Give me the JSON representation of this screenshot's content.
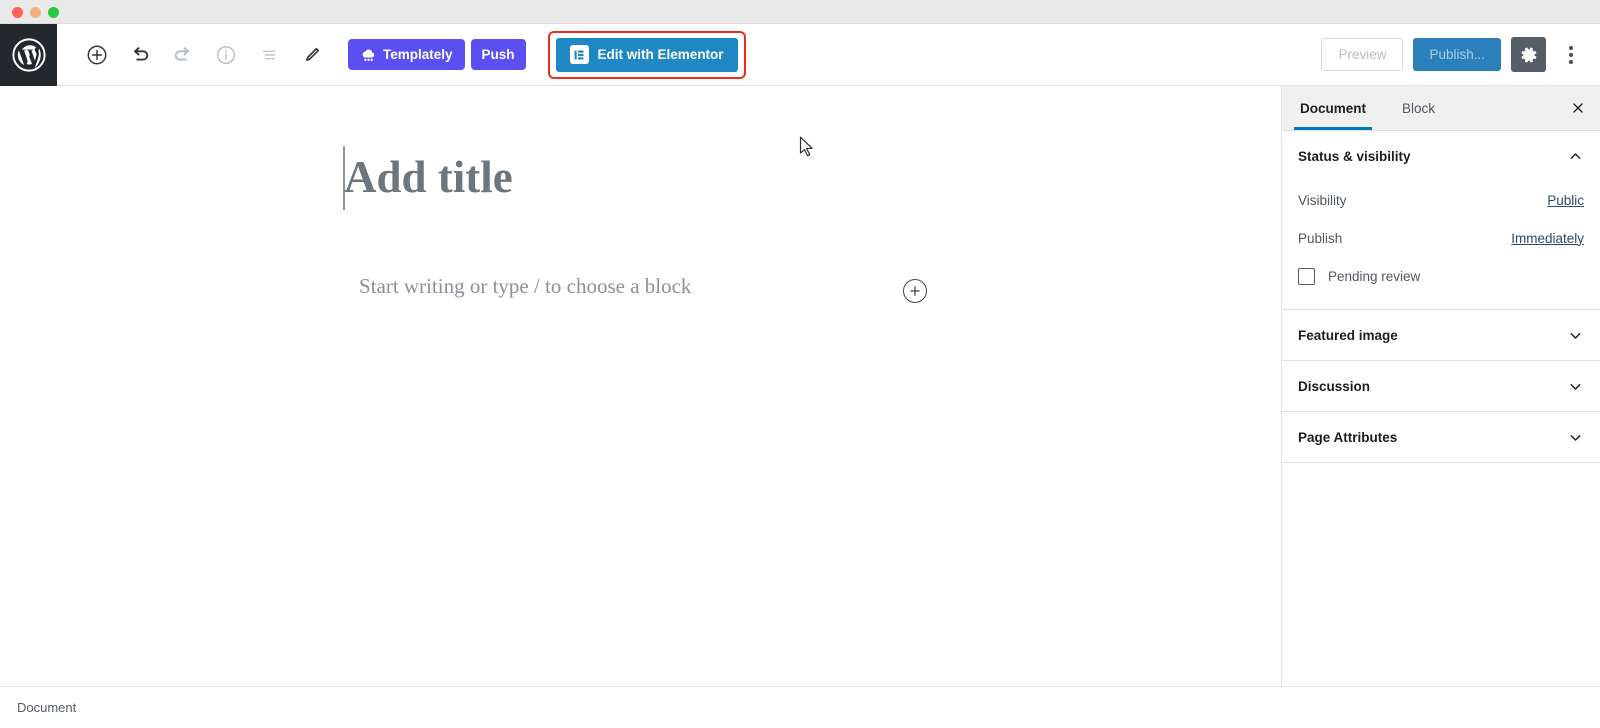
{
  "window": {
    "traffic_lights": [
      {
        "name": "close",
        "color": "#ff5f57"
      },
      {
        "name": "minimize",
        "color": "#f0b27a"
      },
      {
        "name": "zoom",
        "color": "#28c840"
      }
    ]
  },
  "colors": {
    "wp_dark": "#23282d",
    "plugin_purple": "#5b4ff2",
    "elementor_blue": "#1f88c4",
    "publish_blue": "#2b7fba",
    "accent_blue": "#007cba",
    "highlight_red": "#ef2b21",
    "gear_bg": "#555d66"
  },
  "adminbar": {
    "logo_label": "wordpress-logo",
    "tools": [
      {
        "name": "add-block-button",
        "icon": "plus-circle-icon",
        "label": "Add block",
        "disabled": false
      },
      {
        "name": "undo-button",
        "icon": "undo-icon",
        "label": "Undo",
        "disabled": false
      },
      {
        "name": "redo-button",
        "icon": "redo-icon",
        "label": "Redo",
        "disabled": true
      },
      {
        "name": "details-button",
        "icon": "info-circle-icon",
        "label": "Details",
        "disabled": false
      },
      {
        "name": "list-view-button",
        "icon": "list-view-icon",
        "label": "List view",
        "disabled": false
      },
      {
        "name": "edit-mode-button",
        "icon": "pencil-icon",
        "label": "Edit",
        "disabled": false
      }
    ],
    "templately_label": "Templately",
    "templately_icon": "cloud-dots-icon",
    "push_label": "Push",
    "elementor_label": "Edit with Elementor",
    "elementor_icon": "elementor-panel-icon",
    "elementor_highlighted": true,
    "preview_label": "Preview",
    "preview_disabled": true,
    "publish_label": "Publish...",
    "publish_disabled": true,
    "settings_icon": "gear-icon",
    "more_menu_icon": "kebab-menu-icon"
  },
  "canvas": {
    "title_placeholder": "Add title",
    "paragraph_placeholder": "Start writing or type / to choose a block",
    "inserter_icon": "plus-circle-icon",
    "cursor_icon": "mouse-pointer-icon"
  },
  "sidebar": {
    "tabs": [
      {
        "label": "Document",
        "active": true
      },
      {
        "label": "Block",
        "active": false
      }
    ],
    "close_icon": "close-icon",
    "panels": [
      {
        "title": "Status & visibility",
        "expanded": true,
        "chevron": "chevron-up-icon",
        "rows": [
          {
            "label": "Visibility",
            "value": "Public"
          },
          {
            "label": "Publish",
            "value": "Immediately"
          }
        ],
        "checkbox": {
          "label": "Pending review",
          "checked": false
        }
      },
      {
        "title": "Featured image",
        "expanded": false,
        "chevron": "chevron-down-icon"
      },
      {
        "title": "Discussion",
        "expanded": false,
        "chevron": "chevron-down-icon"
      },
      {
        "title": "Page Attributes",
        "expanded": false,
        "chevron": "chevron-down-icon"
      }
    ]
  },
  "footer": {
    "breadcrumb": "Document"
  }
}
